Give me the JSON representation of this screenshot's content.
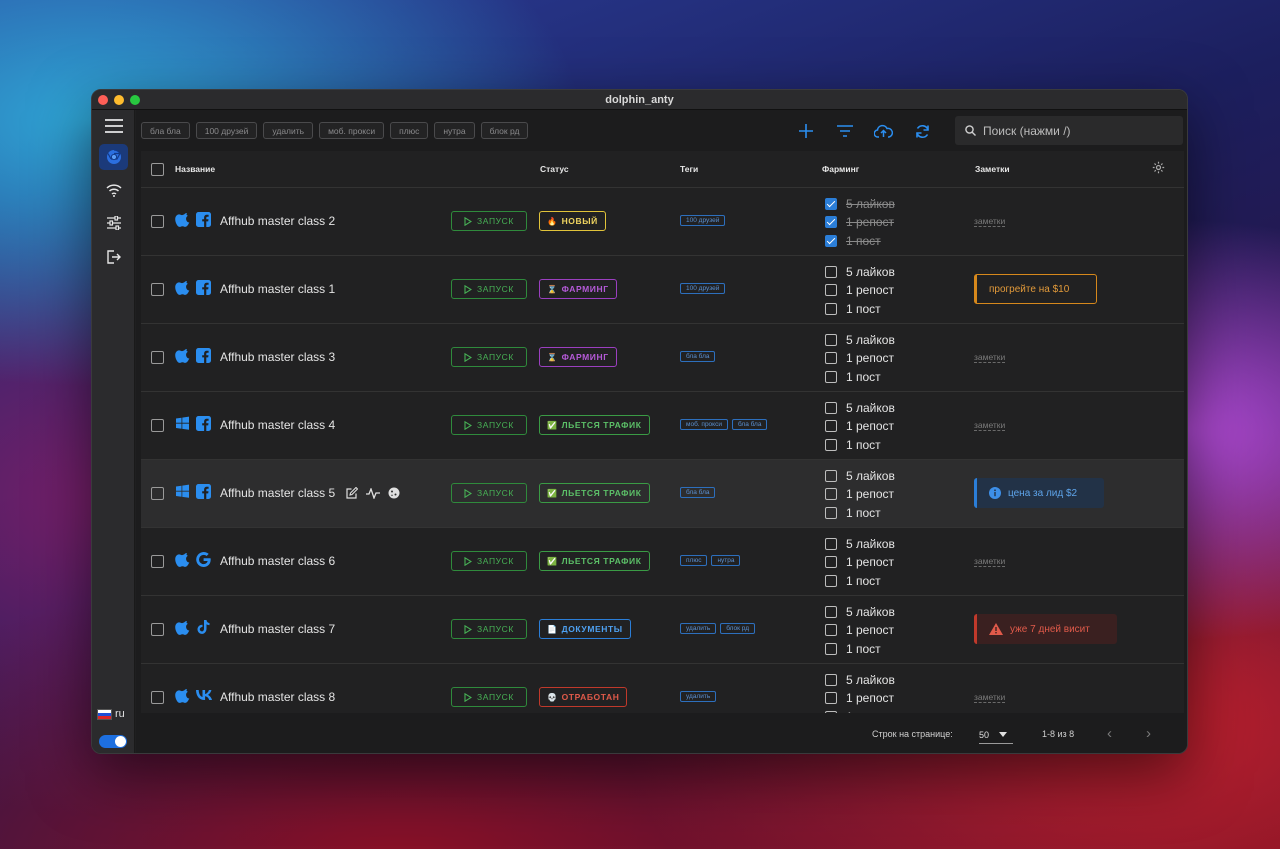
{
  "window": {
    "title": "dolphin_anty"
  },
  "sidebar": {
    "lang": "ru"
  },
  "toolbar": {
    "chips": [
      "бла бла",
      "100 друзей",
      "удалить",
      "моб. прокси",
      "плюс",
      "нутра",
      "блок рд"
    ],
    "search_placeholder": "Поиск (нажми /)"
  },
  "table": {
    "headers": {
      "name": "Название",
      "status": "Статус",
      "tags": "Теги",
      "farming": "Фарминг",
      "notes": "Заметки"
    },
    "run_label": "ЗАПУСК",
    "farm_labels": [
      "5 лайков",
      "1 репост",
      "1 пост"
    ],
    "note_placeholder": "заметки",
    "rows": [
      {
        "os": "apple",
        "social": "facebook",
        "name": "Affhub master class 2",
        "status": "НОВЫЙ",
        "status_icon": "🔥",
        "status_kind": "new",
        "tags": [
          "100 друзей"
        ],
        "farm_done": [
          true,
          true,
          true
        ],
        "note": "",
        "note_kind": ""
      },
      {
        "os": "apple",
        "social": "facebook",
        "name": "Affhub master class 1",
        "status": "ФАРМИНГ",
        "status_icon": "⌛",
        "status_kind": "farm",
        "tags": [
          "100 друзей"
        ],
        "farm_done": [
          false,
          false,
          false
        ],
        "note": "прогрейте на $10",
        "note_kind": "orange"
      },
      {
        "os": "apple",
        "social": "facebook",
        "name": "Affhub master class 3",
        "status": "ФАРМИНГ",
        "status_icon": "⌛",
        "status_kind": "farm",
        "tags": [
          "бла бла"
        ],
        "farm_done": [
          false,
          false,
          false
        ],
        "note": "",
        "note_kind": ""
      },
      {
        "os": "windows",
        "social": "facebook",
        "name": "Affhub master class 4",
        "status": "ЛЬЕТСЯ ТРАФИК",
        "status_icon": "✅",
        "status_kind": "traffic",
        "tags": [
          "моб. прокси",
          "бла бла"
        ],
        "farm_done": [
          false,
          false,
          false
        ],
        "note": "",
        "note_kind": ""
      },
      {
        "os": "windows",
        "social": "facebook",
        "name": "Affhub master class 5",
        "status": "ЛЬЕТСЯ ТРАФИК",
        "status_icon": "✅",
        "status_kind": "traffic",
        "tags": [
          "бла бла"
        ],
        "farm_done": [
          false,
          false,
          false
        ],
        "note": "цена за лид $2",
        "note_kind": "blue",
        "highlight": true
      },
      {
        "os": "apple",
        "social": "google",
        "name": "Affhub master class 6",
        "status": "ЛЬЕТСЯ ТРАФИК",
        "status_icon": "✅",
        "status_kind": "traffic",
        "tags": [
          "плюс",
          "нутра"
        ],
        "farm_done": [
          false,
          false,
          false
        ],
        "note": "",
        "note_kind": ""
      },
      {
        "os": "apple",
        "social": "tiktok",
        "name": "Affhub master class 7",
        "status": "ДОКУМЕНТЫ",
        "status_icon": "📄",
        "status_kind": "docs",
        "tags": [
          "удалить",
          "блок рд"
        ],
        "farm_done": [
          false,
          false,
          false
        ],
        "note": "уже 7 дней висит",
        "note_kind": "red"
      },
      {
        "os": "apple",
        "social": "vk",
        "name": "Affhub master class 8",
        "status": "ОТРАБОТАН",
        "status_icon": "💀",
        "status_kind": "done",
        "tags": [
          "удалить"
        ],
        "farm_done": [
          false,
          false,
          false
        ],
        "note": "",
        "note_kind": ""
      }
    ]
  },
  "footer": {
    "rows_label": "Строк на странице:",
    "rows_value": "50",
    "range": "1-8 из 8"
  },
  "colors": {
    "accent": "#2b7ed8",
    "run": "#47b055"
  }
}
